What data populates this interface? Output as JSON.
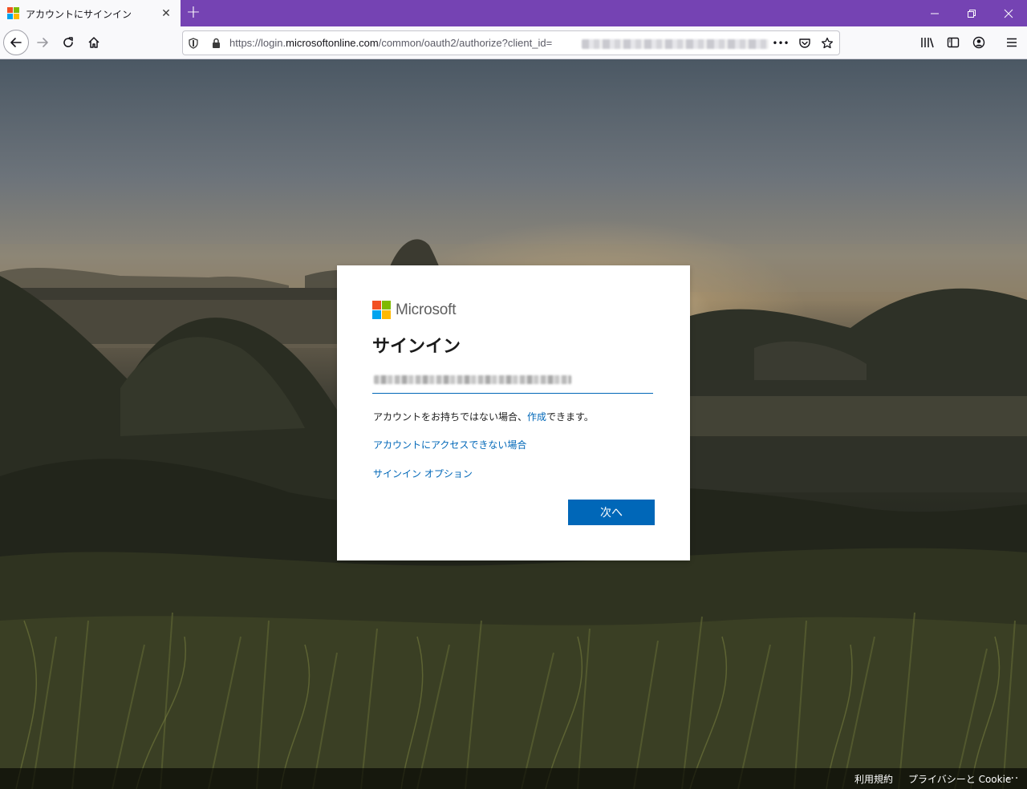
{
  "browser": {
    "tab": {
      "title": "アカウントにサインイン",
      "close_glyph": "✕"
    },
    "new_tab_glyph": "+",
    "url": {
      "scheme": "https://login.",
      "host": "microsoftonline.com",
      "path": "/common/oauth2/authorize?client_id="
    },
    "url_more_glyph": "•••"
  },
  "signin": {
    "brand": "Microsoft",
    "title": "サインイン",
    "email_value": "",
    "no_account_prefix": "アカウントをお持ちではない場合、",
    "create_link": "作成",
    "no_account_suffix": "できます。",
    "cant_access_link": "アカウントにアクセスできない場合",
    "signin_options_link": "サインイン オプション",
    "next_button": "次へ"
  },
  "footer": {
    "terms": "利用規約",
    "privacy": "プライバシーと Cookie",
    "more": "..."
  },
  "colors": {
    "tabstrip": "#7543b3",
    "accent_blue": "#0067b8",
    "ms_red": "#f25022",
    "ms_green": "#7fba00",
    "ms_blue": "#00a4ef",
    "ms_yellow": "#ffb900"
  },
  "icons": {
    "back": "back-arrow-icon",
    "forward": "forward-arrow-icon",
    "reload": "reload-icon",
    "home": "home-icon",
    "tracking": "shield-icon",
    "lock": "lock-icon",
    "pocket": "pocket-icon",
    "bookmark": "star-icon",
    "library": "library-icon",
    "sidebar": "sidebar-icon",
    "account": "account-icon",
    "menu": "hamburger-menu-icon"
  }
}
